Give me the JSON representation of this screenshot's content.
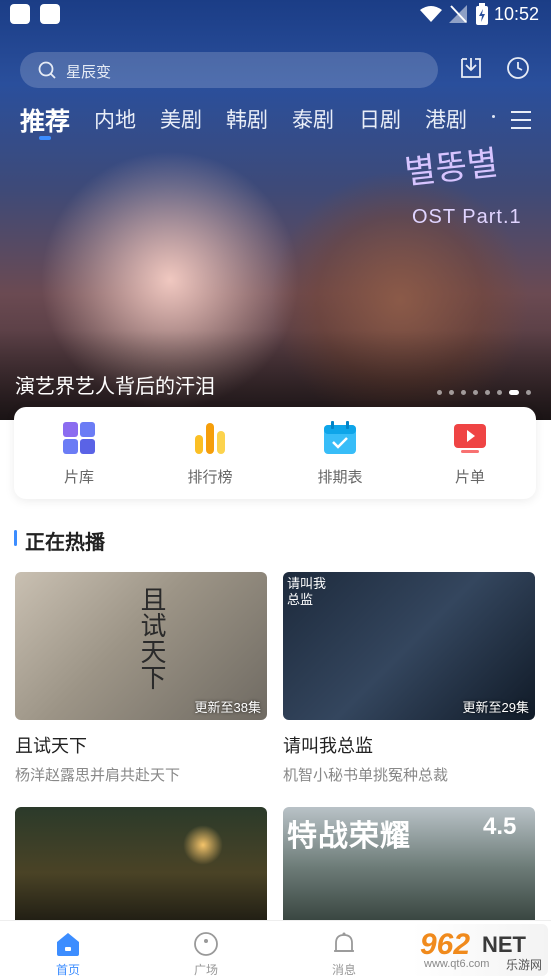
{
  "status_bar": {
    "time": "10:52"
  },
  "search": {
    "placeholder": "星辰变"
  },
  "tabs": [
    {
      "label": "推荐"
    },
    {
      "label": "内地"
    },
    {
      "label": "美剧"
    },
    {
      "label": "韩剧"
    },
    {
      "label": "泰剧"
    },
    {
      "label": "日剧"
    },
    {
      "label": "港剧"
    }
  ],
  "banner": {
    "poster_title_korean": "별똥별",
    "poster_subtitle": "OST Part.1",
    "caption": "演艺界艺人背后的汗泪",
    "page_count": 8,
    "active_page": 7
  },
  "quick_links": [
    {
      "label": "片库",
      "icon": "library-icon"
    },
    {
      "label": "排行榜",
      "icon": "ranking-icon"
    },
    {
      "label": "排期表",
      "icon": "calendar-icon"
    },
    {
      "label": "片单",
      "icon": "playlist-icon"
    }
  ],
  "section": {
    "title": "正在热播"
  },
  "shows": [
    {
      "title": "且试天下",
      "subtitle": "杨洋赵露思并肩共赴天下",
      "badge": "更新至38集",
      "poster_text": "且试天下"
    },
    {
      "title": "请叫我总监",
      "subtitle": "机智小秘书单挑冤种总裁",
      "badge": "更新至29集",
      "poster_text": "请叫我总监"
    },
    {
      "title": "",
      "subtitle": "",
      "badge": "",
      "poster_text": ""
    },
    {
      "title": "",
      "subtitle": "",
      "badge": "",
      "poster_text": "特战荣耀",
      "poster_extra": "4.5"
    }
  ],
  "bottom_nav": [
    {
      "label": "首页",
      "icon": "home-icon"
    },
    {
      "label": "广场",
      "icon": "square-icon"
    },
    {
      "label": "消息",
      "icon": "bell-icon"
    }
  ],
  "watermark": {
    "brand": "962",
    "net": "NET",
    "site_cn": "乐游网",
    "url": "www.qt6.com"
  }
}
